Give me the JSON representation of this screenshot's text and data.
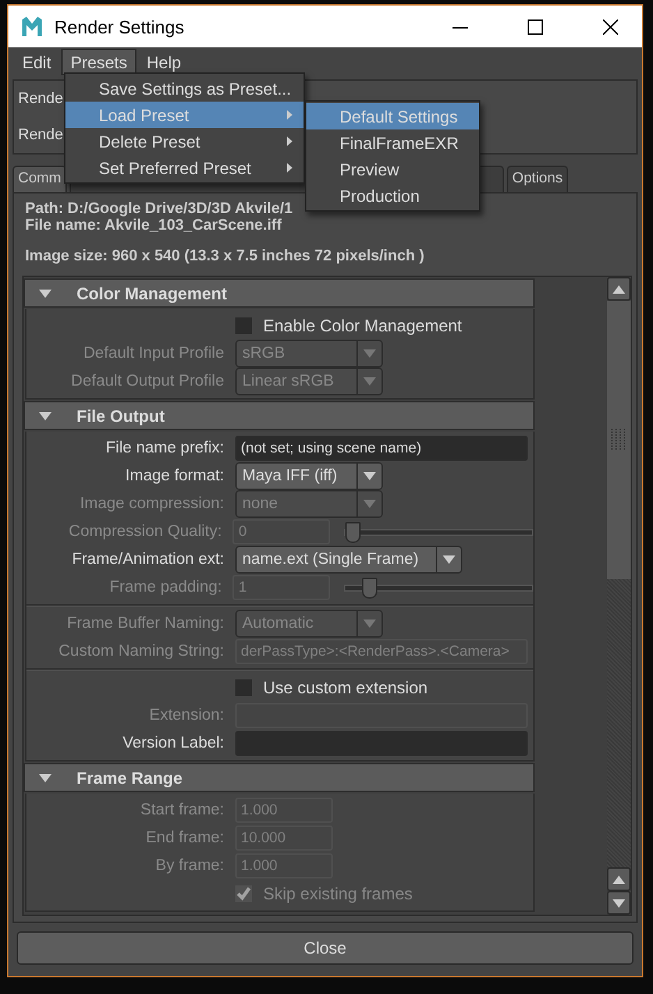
{
  "window": {
    "title": "Render Settings"
  },
  "menubar": [
    {
      "label": "Edit",
      "selected": false
    },
    {
      "label": "Presets",
      "selected": true
    },
    {
      "label": "Help",
      "selected": false
    }
  ],
  "presets_menu": [
    {
      "label": "Save Settings as Preset...",
      "has_submenu": false,
      "selected": false
    },
    {
      "label": "Load Preset",
      "has_submenu": true,
      "selected": true
    },
    {
      "label": "Delete Preset",
      "has_submenu": true,
      "selected": false
    },
    {
      "label": "Set Preferred Preset",
      "has_submenu": true,
      "selected": false
    }
  ],
  "load_preset_submenu": [
    {
      "label": "Default Settings",
      "selected": true
    },
    {
      "label": "FinalFrameEXR",
      "selected": false
    },
    {
      "label": "Preview",
      "selected": false
    },
    {
      "label": "Production",
      "selected": false
    }
  ],
  "render_rows": [
    "Rende",
    "Rende"
  ],
  "tabs": [
    {
      "label": "Comm",
      "selected": true
    },
    {
      "label": "Options",
      "selected": false
    }
  ],
  "path_info": {
    "path": "Path: D:/Google Drive/3D/3D Akvile/1",
    "file_name": "File name:  Akvile_103_CarScene.iff",
    "image_size": "Image size: 960 x 540 (13.3 x 7.5 inches 72 pixels/inch )"
  },
  "sections": [
    {
      "title": "Color Management",
      "expanded": true,
      "rows": [
        {
          "kind": "checkbox",
          "label": "Enable Color Management",
          "checked": false,
          "disabled": false
        },
        {
          "kind": "dropdown",
          "label": "Default Input Profile",
          "value": "sRGB",
          "disabled": true
        },
        {
          "kind": "dropdown",
          "label": "Default Output Profile",
          "value": "Linear sRGB",
          "disabled": true
        }
      ]
    },
    {
      "title": "File Output",
      "expanded": true,
      "rows": [
        {
          "kind": "text",
          "label": "File name prefix:",
          "value": "(not set; using scene name)",
          "disabled": false
        },
        {
          "kind": "dropdown",
          "label": "Image format:",
          "value": "Maya IFF (iff)",
          "disabled": false
        },
        {
          "kind": "dropdown",
          "label": "Image compression:",
          "value": "none",
          "disabled": true
        },
        {
          "kind": "slider",
          "label": "Compression Quality:",
          "value": "0",
          "level": 0,
          "disabled": true
        },
        {
          "kind": "dropdown",
          "label": "Frame/Animation ext:",
          "value": "name.ext (Single Frame)",
          "disabled": false
        },
        {
          "kind": "slider",
          "label": "Frame padding:",
          "value": "1",
          "level": 0.1,
          "disabled": true
        },
        {
          "kind": "divider"
        },
        {
          "kind": "dropdown",
          "label": "Frame Buffer Naming:",
          "value": "Automatic",
          "disabled": true
        },
        {
          "kind": "text",
          "label": "Custom Naming String:",
          "value": "derPassType>:<RenderPass>.<Camera>",
          "disabled": true
        },
        {
          "kind": "divider"
        },
        {
          "kind": "checkbox",
          "label": "Use custom extension",
          "checked": false,
          "disabled": false
        },
        {
          "kind": "text",
          "label": "Extension:",
          "disabled": true
        },
        {
          "kind": "text",
          "label": "Version Label:",
          "disabled": false
        }
      ]
    },
    {
      "title": "Frame Range",
      "expanded": true,
      "rows": [
        {
          "kind": "text",
          "label": "Start frame:",
          "value": "1.000",
          "disabled": true
        },
        {
          "kind": "text",
          "label": "End frame:",
          "value": "10.000",
          "disabled": true
        },
        {
          "kind": "text",
          "label": "By frame:",
          "value": "1.000",
          "disabled": true
        },
        {
          "kind": "checkbox",
          "label": "Skip existing frames",
          "checked": true,
          "disabled": true
        }
      ]
    }
  ],
  "close_button": "Close"
}
